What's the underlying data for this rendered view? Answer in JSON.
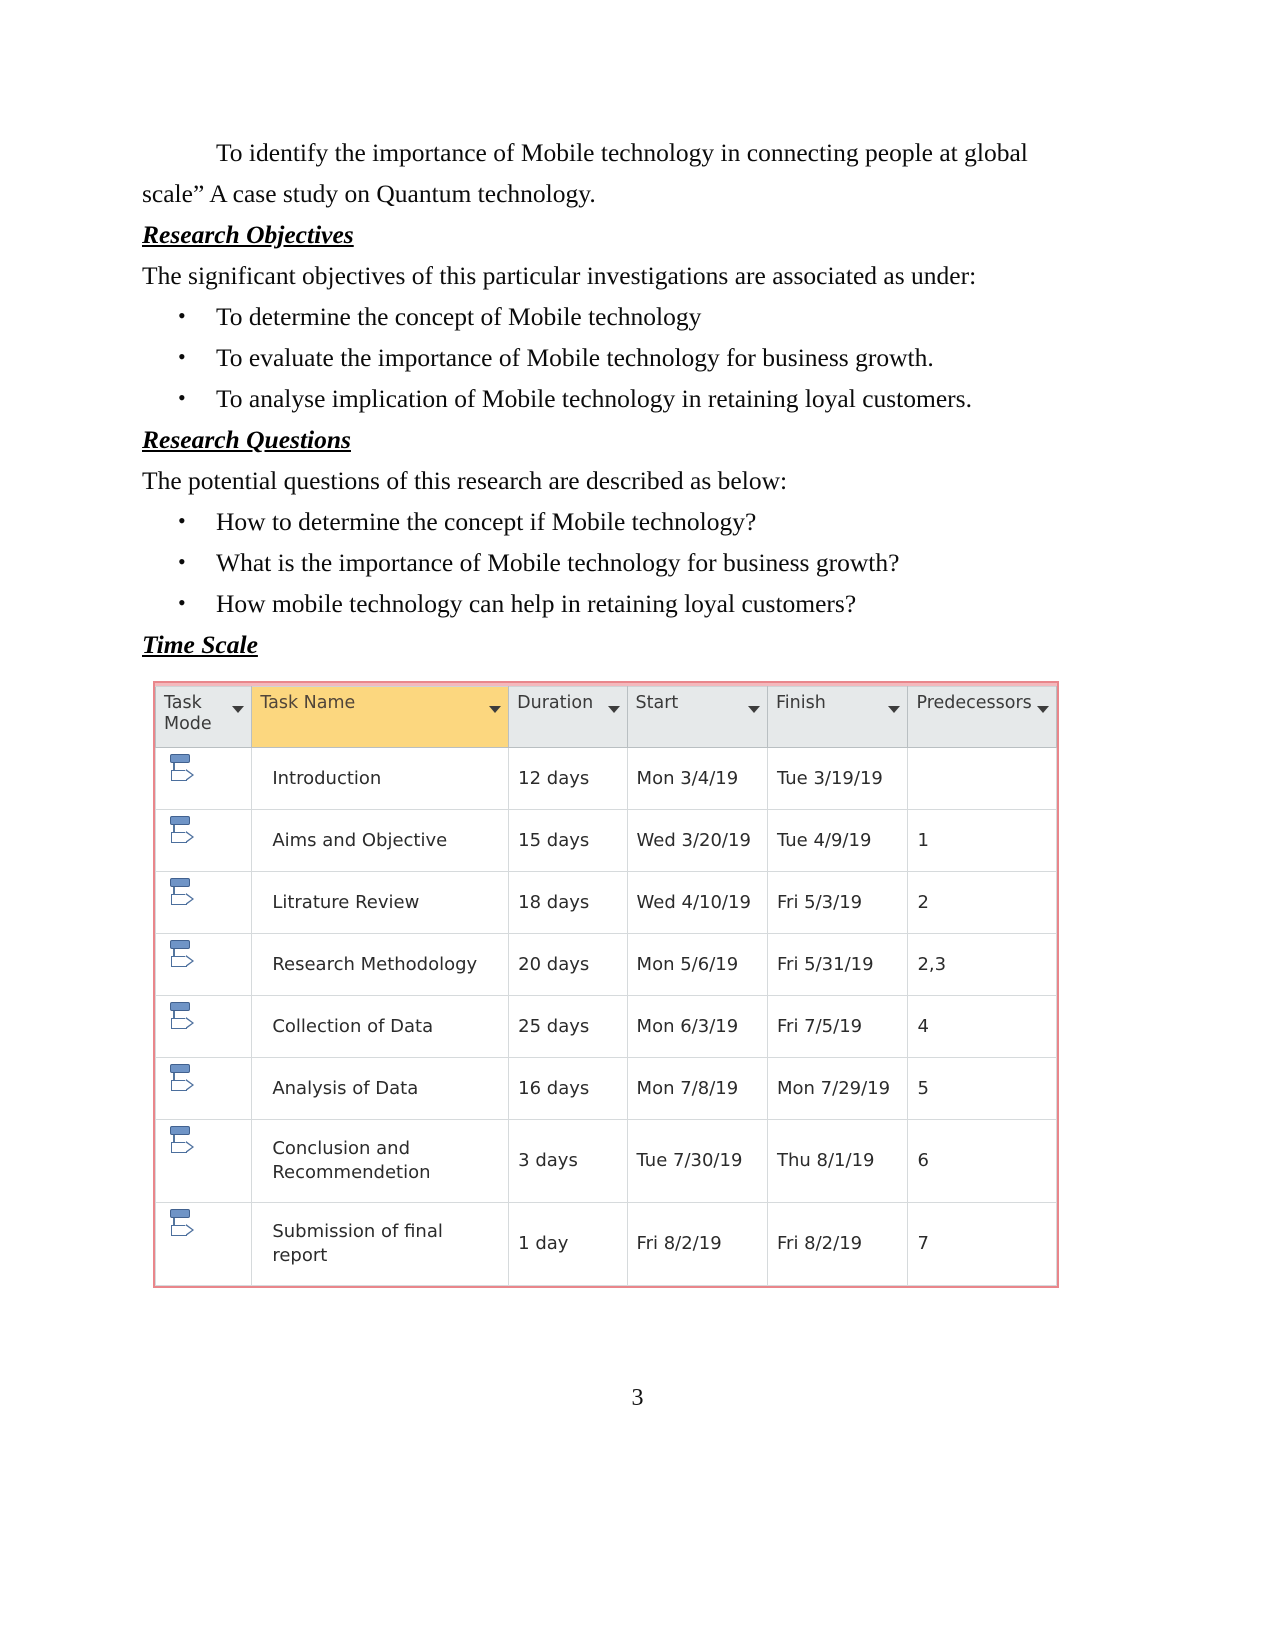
{
  "document": {
    "page_number": "3",
    "body": {
      "intro_paragraph": "To identify the importance of Mobile technology in connecting people at global scale” A case study on Quantum technology.",
      "objectives_heading": "Research Objectives",
      "objectives_lead": "The significant objectives of this particular investigations are associated as under:",
      "objectives": [
        "To determine the concept of Mobile technology",
        "To evaluate the importance of Mobile technology for business growth.",
        "To analyse implication of Mobile technology in retaining loyal customers."
      ],
      "questions_heading": "Research Questions",
      "questions_lead": "The potential questions of this research are described as below:",
      "questions": [
        "How to determine the concept if Mobile technology?",
        "What is the importance of Mobile technology for business growth?",
        "How mobile technology can help in retaining loyal customers?"
      ],
      "timescale_heading": "Time Scale",
      "bullet_glyph": "•"
    }
  },
  "project_table": {
    "highlight_color": "#fcd77f",
    "border_color": "#e9868b",
    "header_color": "#e6e9ea",
    "columns": [
      {
        "label": "Task\nMode",
        "highlight": false,
        "has_filter": true
      },
      {
        "label": "Task Name",
        "highlight": true,
        "has_filter": true
      },
      {
        "label": "Duration",
        "highlight": false,
        "has_filter": true
      },
      {
        "label": "Start",
        "highlight": false,
        "has_filter": true
      },
      {
        "label": "Finish",
        "highlight": false,
        "has_filter": true
      },
      {
        "label": "Predecessors",
        "highlight": false,
        "has_filter": true
      }
    ],
    "rows": [
      {
        "mode": "auto-schedule-icon",
        "name": "Introduction",
        "duration": "12 days",
        "start": "Mon 3/4/19",
        "finish": "Tue 3/19/19",
        "predecessors": ""
      },
      {
        "mode": "auto-schedule-icon",
        "name": "Aims and Objective",
        "duration": "15 days",
        "start": "Wed 3/20/19",
        "finish": "Tue 4/9/19",
        "predecessors": "1"
      },
      {
        "mode": "auto-schedule-icon",
        "name": "Litrature Review",
        "duration": "18 days",
        "start": "Wed 4/10/19",
        "finish": "Fri 5/3/19",
        "predecessors": "2"
      },
      {
        "mode": "auto-schedule-icon",
        "name": "Research Methodology",
        "duration": "20 days",
        "start": "Mon 5/6/19",
        "finish": "Fri 5/31/19",
        "predecessors": "2,3"
      },
      {
        "mode": "auto-schedule-icon",
        "name": "Collection of Data",
        "duration": "25 days",
        "start": "Mon 6/3/19",
        "finish": "Fri 7/5/19",
        "predecessors": "4"
      },
      {
        "mode": "auto-schedule-icon",
        "name": "Analysis of Data",
        "duration": "16 days",
        "start": "Mon 7/8/19",
        "finish": "Mon 7/29/19",
        "predecessors": "5"
      },
      {
        "mode": "auto-schedule-icon",
        "name": "Conclusion and Recommendetion",
        "duration": "3 days",
        "start": "Tue 7/30/19",
        "finish": "Thu 8/1/19",
        "predecessors": "6"
      },
      {
        "mode": "auto-schedule-icon",
        "name": "Submission of final report",
        "duration": "1 day",
        "start": "Fri 8/2/19",
        "finish": "Fri 8/2/19",
        "predecessors": "7"
      }
    ]
  }
}
